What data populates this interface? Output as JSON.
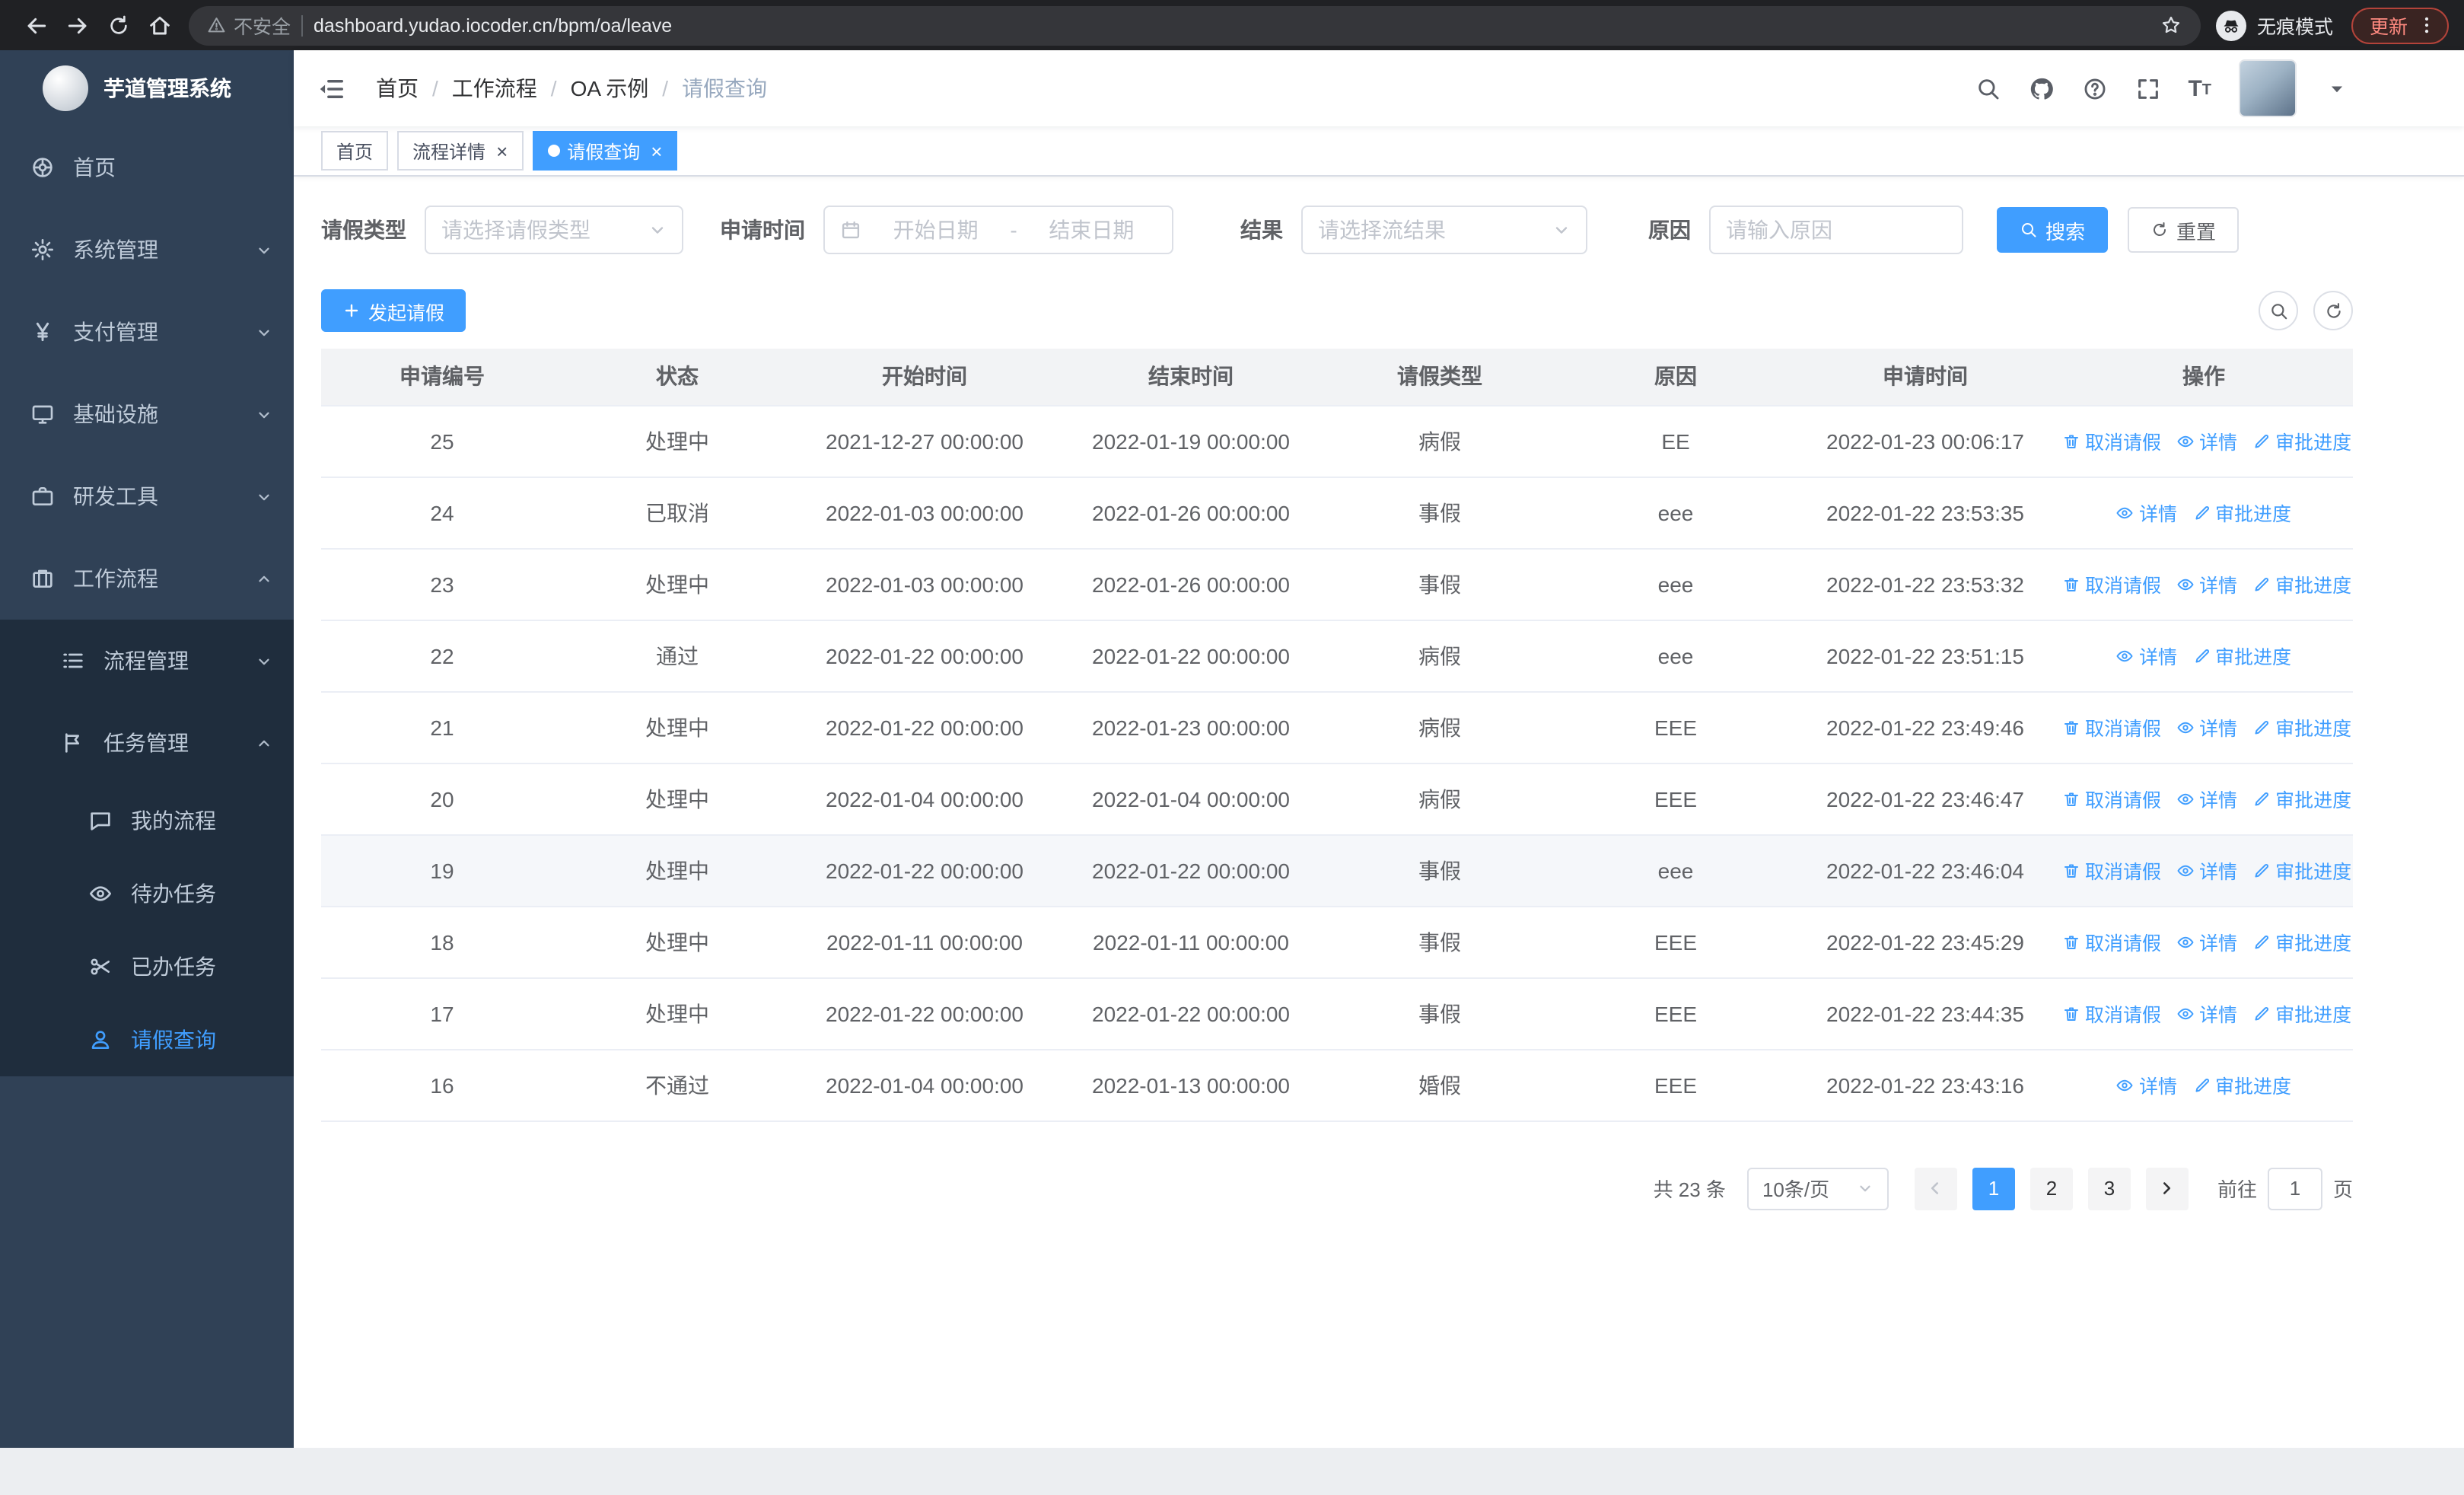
{
  "browser": {
    "security_label": "不安全",
    "url": "dashboard.yudao.iocoder.cn/bpm/oa/leave",
    "incognito_label": "无痕模式",
    "update_label": "更新"
  },
  "sidebar": {
    "logo_title": "芋道管理系统",
    "items": [
      {
        "key": "home",
        "label": "首页",
        "icon": "i-wheel",
        "icon_name": "dashboard-icon",
        "level": 1
      },
      {
        "key": "system",
        "label": "系统管理",
        "icon": "i-gear",
        "icon_name": "gear-icon",
        "level": 1,
        "expandable": true,
        "expanded": false
      },
      {
        "key": "payment",
        "label": "支付管理",
        "icon": "i-yen",
        "icon_name": "yen-icon",
        "level": 1,
        "expandable": true,
        "expanded": false
      },
      {
        "key": "infrastructure",
        "label": "基础设施",
        "icon": "i-monitor",
        "icon_name": "monitor-icon",
        "level": 1,
        "expandable": true,
        "expanded": false
      },
      {
        "key": "devtools",
        "label": "研发工具",
        "icon": "i-briefcase",
        "icon_name": "briefcase-icon",
        "level": 1,
        "expandable": true,
        "expanded": false
      },
      {
        "key": "workflow",
        "label": "工作流程",
        "icon": "i-suitcase",
        "icon_name": "suitcase-icon",
        "level": 1,
        "expandable": true,
        "expanded": true
      },
      {
        "key": "process-mgmt",
        "label": "流程管理",
        "icon": "i-list",
        "icon_name": "list-icon",
        "level": 2,
        "expandable": true,
        "expanded": false
      },
      {
        "key": "task-mgmt",
        "label": "任务管理",
        "icon": "i-flag",
        "icon_name": "flag-icon",
        "level": 2,
        "expandable": true,
        "expanded": true
      },
      {
        "key": "my-process",
        "label": "我的流程",
        "icon": "i-chat",
        "icon_name": "chat-icon",
        "level": 3
      },
      {
        "key": "todo-task",
        "label": "待办任务",
        "icon": "i-eye",
        "icon_name": "eye-icon",
        "level": 3
      },
      {
        "key": "done-task",
        "label": "已办任务",
        "icon": "i-scissors",
        "icon_name": "scissors-icon",
        "level": 3
      },
      {
        "key": "leave-query",
        "label": "请假查询",
        "icon": "i-user",
        "icon_name": "user-icon",
        "level": 3,
        "active": true
      }
    ]
  },
  "header": {
    "breadcrumb": [
      "首页",
      "工作流程",
      "OA 示例",
      "请假查询"
    ]
  },
  "tabs": [
    {
      "key": "home",
      "label": "首页",
      "closable": false,
      "active": false
    },
    {
      "key": "process-detail",
      "label": "流程详情",
      "closable": true,
      "active": false
    },
    {
      "key": "leave-query",
      "label": "请假查询",
      "closable": true,
      "active": true
    }
  ],
  "filters": {
    "leave_type": {
      "label": "请假类型",
      "placeholder": "请选择请假类型"
    },
    "apply_time": {
      "label": "申请时间",
      "start_placeholder": "开始日期",
      "separator": "-",
      "end_placeholder": "结束日期"
    },
    "result": {
      "label": "结果",
      "placeholder": "请选择流结果"
    },
    "reason": {
      "label": "原因",
      "placeholder": "请输入原因"
    },
    "search_label": "搜索",
    "reset_label": "重置"
  },
  "toolbar": {
    "create_label": "发起请假"
  },
  "table": {
    "columns": [
      "申请编号",
      "状态",
      "开始时间",
      "结束时间",
      "请假类型",
      "原因",
      "申请时间",
      "操作"
    ],
    "action_labels": {
      "cancel": "取消请假",
      "detail": "详情",
      "progress": "审批进度"
    },
    "rows": [
      {
        "id": "25",
        "status": "处理中",
        "start": "2021-12-27 00:00:00",
        "end": "2022-01-19 00:00:00",
        "type": "病假",
        "reason": "EE",
        "applied": "2022-01-23 00:06:17",
        "actions": [
          "cancel",
          "detail",
          "progress"
        ],
        "highlight": false
      },
      {
        "id": "24",
        "status": "已取消",
        "start": "2022-01-03 00:00:00",
        "end": "2022-01-26 00:00:00",
        "type": "事假",
        "reason": "eee",
        "applied": "2022-01-22 23:53:35",
        "actions": [
          "detail",
          "progress"
        ],
        "highlight": false
      },
      {
        "id": "23",
        "status": "处理中",
        "start": "2022-01-03 00:00:00",
        "end": "2022-01-26 00:00:00",
        "type": "事假",
        "reason": "eee",
        "applied": "2022-01-22 23:53:32",
        "actions": [
          "cancel",
          "detail",
          "progress"
        ],
        "highlight": false
      },
      {
        "id": "22",
        "status": "通过",
        "start": "2022-01-22 00:00:00",
        "end": "2022-01-22 00:00:00",
        "type": "病假",
        "reason": "eee",
        "applied": "2022-01-22 23:51:15",
        "actions": [
          "detail",
          "progress"
        ],
        "highlight": false
      },
      {
        "id": "21",
        "status": "处理中",
        "start": "2022-01-22 00:00:00",
        "end": "2022-01-23 00:00:00",
        "type": "病假",
        "reason": "EEE",
        "applied": "2022-01-22 23:49:46",
        "actions": [
          "cancel",
          "detail",
          "progress"
        ],
        "highlight": false
      },
      {
        "id": "20",
        "status": "处理中",
        "start": "2022-01-04 00:00:00",
        "end": "2022-01-04 00:00:00",
        "type": "病假",
        "reason": "EEE",
        "applied": "2022-01-22 23:46:47",
        "actions": [
          "cancel",
          "detail",
          "progress"
        ],
        "highlight": false
      },
      {
        "id": "19",
        "status": "处理中",
        "start": "2022-01-22 00:00:00",
        "end": "2022-01-22 00:00:00",
        "type": "事假",
        "reason": "eee",
        "applied": "2022-01-22 23:46:04",
        "actions": [
          "cancel",
          "detail",
          "progress"
        ],
        "highlight": true
      },
      {
        "id": "18",
        "status": "处理中",
        "start": "2022-01-11 00:00:00",
        "end": "2022-01-11 00:00:00",
        "type": "事假",
        "reason": "EEE",
        "applied": "2022-01-22 23:45:29",
        "actions": [
          "cancel",
          "detail",
          "progress"
        ],
        "highlight": false
      },
      {
        "id": "17",
        "status": "处理中",
        "start": "2022-01-22 00:00:00",
        "end": "2022-01-22 00:00:00",
        "type": "事假",
        "reason": "EEE",
        "applied": "2022-01-22 23:44:35",
        "actions": [
          "cancel",
          "detail",
          "progress"
        ],
        "highlight": false
      },
      {
        "id": "16",
        "status": "不通过",
        "start": "2022-01-04 00:00:00",
        "end": "2022-01-13 00:00:00",
        "type": "婚假",
        "reason": "EEE",
        "applied": "2022-01-22 23:43:16",
        "actions": [
          "detail",
          "progress"
        ],
        "highlight": false
      }
    ]
  },
  "pagination": {
    "total": "共 23 条",
    "page_size": "10条/页",
    "pages": [
      "1",
      "2",
      "3"
    ],
    "active_page": "1",
    "goto_label": "前往",
    "goto_value": "1",
    "unit_label": "页"
  },
  "colors": {
    "primary": "#409eff",
    "sidebar_bg": "#304156",
    "sidebar_submenu_bg": "#1f2d3d",
    "sidebar_text": "#bfcbd9",
    "chrome_bg": "#202124",
    "update_badge_text": "#ff8a80",
    "table_header_bg": "#f2f3f5"
  }
}
